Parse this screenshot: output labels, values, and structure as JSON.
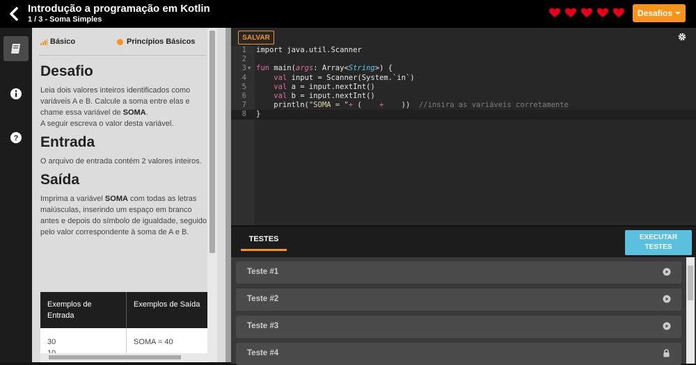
{
  "header": {
    "title": "Introdução a programação em Kotlin",
    "subtitle": "1 / 3 - Soma Simples",
    "lives": 5,
    "desafios_label": "Desafios",
    "heart_color": "#e0001b",
    "accent_color": "#f7941d"
  },
  "rail": {
    "items": [
      {
        "icon": "book-icon",
        "active": true
      },
      {
        "icon": "info-icon",
        "active": false
      },
      {
        "icon": "help-icon",
        "active": false
      }
    ]
  },
  "description": {
    "level": "Básico",
    "topic": "Princípios Básicos",
    "sections": [
      {
        "heading": "Desafio",
        "text": "Leia dois valores inteiros identificados como variáveis A e B. Calcule a soma entre elas e chame essa variável de ",
        "bold": "SOMA",
        "after": ".",
        "extra": "A seguir escreva o valor desta variável."
      },
      {
        "heading": "Entrada",
        "text": "O arquivo de entrada contém 2 valores inteiros."
      },
      {
        "heading": "Saída",
        "pre": "Imprima a variável ",
        "bold": "SOMA",
        "text": " com todas as letras maiúsculas, inserindo um espaço em branco antes e depois do símbolo de igualdade, seguido pelo valor correspondente à soma de A e B."
      }
    ],
    "examples": {
      "headers": [
        "Exemplos de Entrada",
        "Exemplos de Saída"
      ],
      "rows": [
        [
          "30",
          "10",
          "SOMA = 40"
        ]
      ]
    }
  },
  "editor": {
    "save_label": "SALVAR",
    "lines": [
      "1",
      "2",
      "3",
      "4",
      "5",
      "6",
      "7",
      "8"
    ]
  },
  "tests": {
    "tab_label": "TESTES",
    "execute_label_1": "EXECUTAR",
    "execute_label_2": "TESTES",
    "items": [
      {
        "label": "Teste #1",
        "icon": "play-icon"
      },
      {
        "label": "Teste #2",
        "icon": "play-icon"
      },
      {
        "label": "Teste #3",
        "icon": "play-icon"
      },
      {
        "label": "Teste #4",
        "icon": "lock-icon"
      }
    ]
  }
}
